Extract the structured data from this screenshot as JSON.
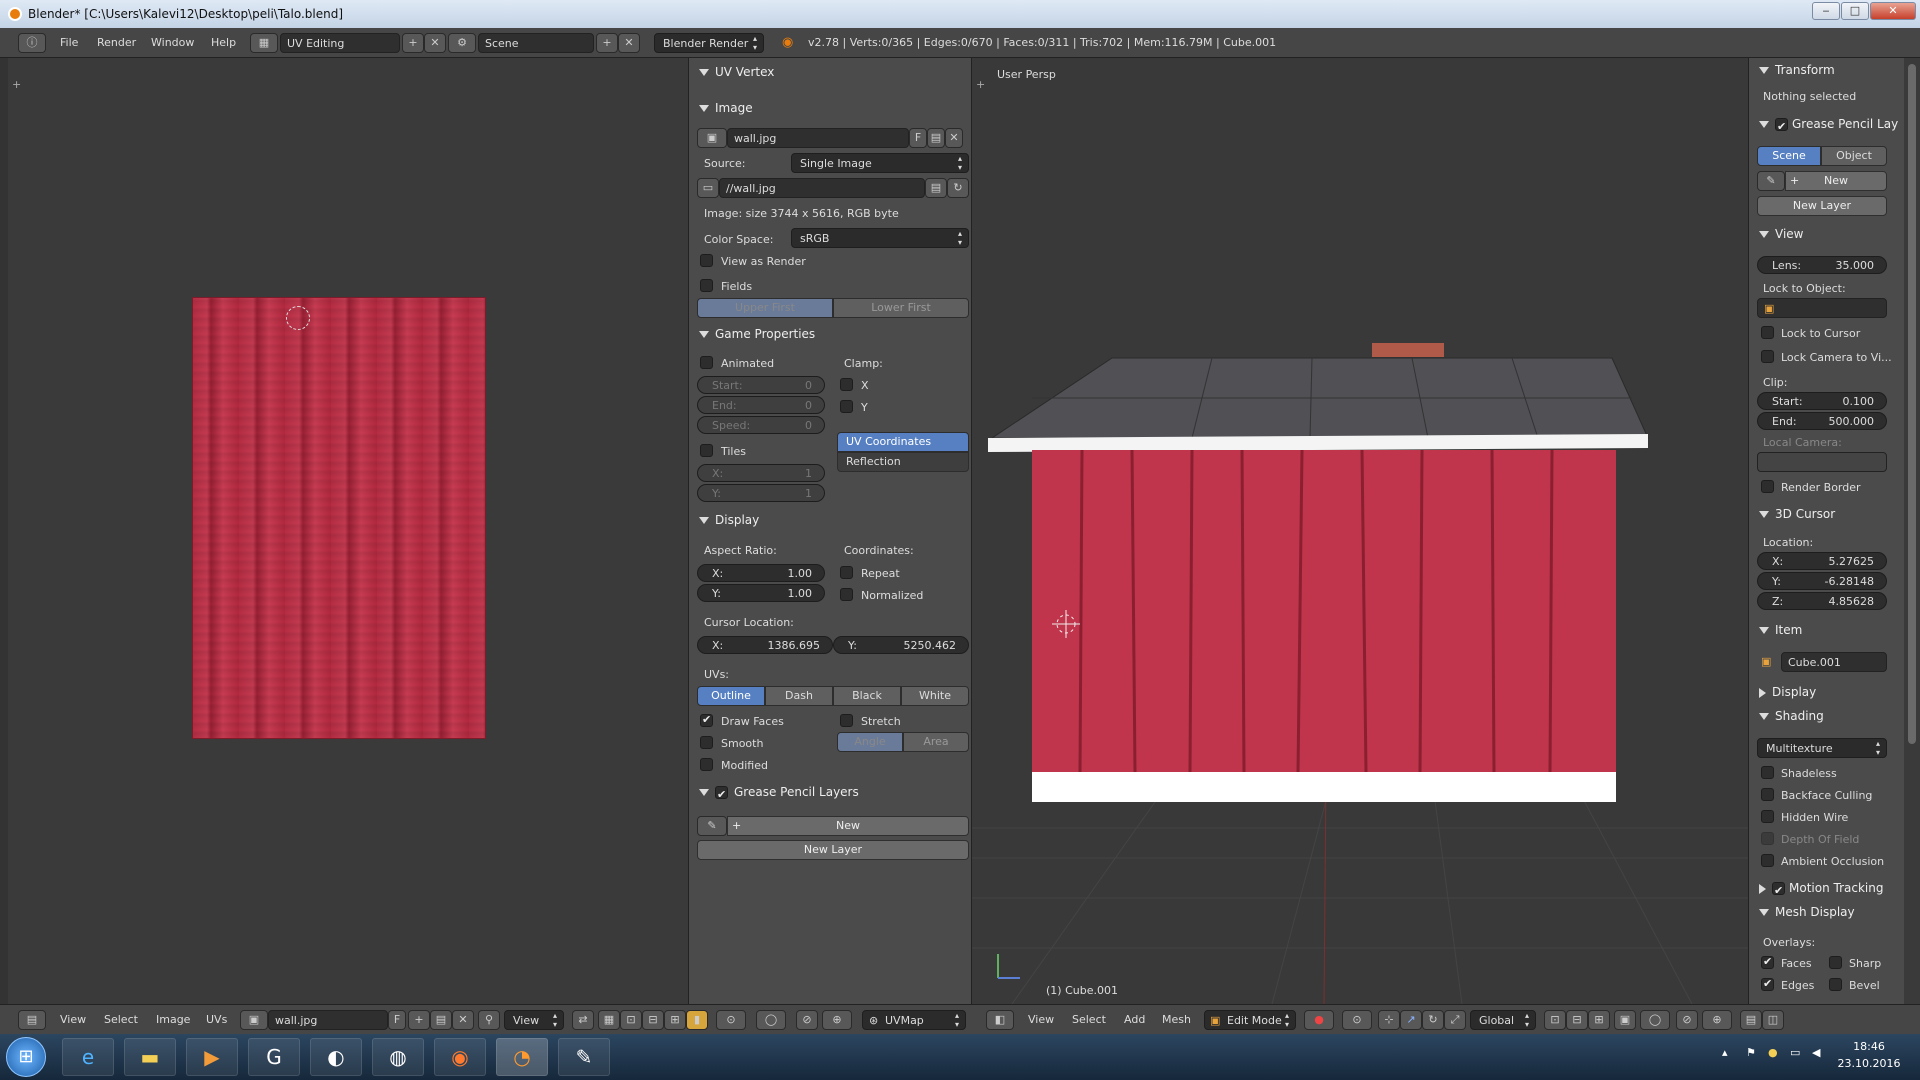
{
  "window": {
    "title": "Blender* [C:\\Users\\Kalevi12\\Desktop\\peli\\Talo.blend]",
    "min": "‒",
    "max": "□",
    "close": "✕"
  },
  "topbar": {
    "menus": [
      "File",
      "Render",
      "Window",
      "Help"
    ],
    "layout": "UV Editing",
    "scene": "Scene",
    "engine": "Blender Render",
    "info": "v2.78 | Verts:0/365 | Edges:0/670 | Faces:0/311 | Tris:702 | Mem:116.79M | Cube.001"
  },
  "uv_panel": {
    "uv_vertex": "UV Vertex",
    "image": {
      "header": "Image",
      "name": "wall.jpg",
      "f": "F",
      "source_label": "Source:",
      "source": "Single Image",
      "path": "//wall.jpg",
      "size": "Image: size 3744 x 5616, RGB byte",
      "colorspace_label": "Color Space:",
      "colorspace": "sRGB",
      "view_as_render": "View as Render",
      "fields": "Fields",
      "upper_first": "Upper First",
      "lower_first": "Lower First"
    },
    "game": {
      "header": "Game Properties",
      "animated": "Animated",
      "start_l": "Start:",
      "start_v": "0",
      "end_l": "End:",
      "end_v": "0",
      "speed_l": "Speed:",
      "speed_v": "0",
      "clamp": "Clamp:",
      "x": "X",
      "y": "Y",
      "uv_coords": "UV Coordinates",
      "reflection": "Reflection",
      "tiles": "Tiles",
      "tx_l": "X:",
      "tx_v": "1",
      "ty_l": "Y:",
      "ty_v": "1"
    },
    "display": {
      "header": "Display",
      "aspect": "Aspect Ratio:",
      "ax_l": "X:",
      "ax_v": "1.00",
      "ay_l": "Y:",
      "ay_v": "1.00",
      "coords": "Coordinates:",
      "repeat": "Repeat",
      "normalized": "Normalized",
      "cursor_loc": "Cursor Location:",
      "cx_l": "X:",
      "cx_v": "1386.695",
      "cy_l": "Y:",
      "cy_v": "5250.462",
      "uvs": "UVs:",
      "outline": "Outline",
      "dash": "Dash",
      "black": "Black",
      "white": "White",
      "draw_faces": "Draw Faces",
      "stretch": "Stretch",
      "smooth": "Smooth",
      "angle": "Angle",
      "area": "Area",
      "modified": "Modified"
    },
    "grease": {
      "header": "Grease Pencil Layers",
      "new": "New",
      "new_layer": "New Layer"
    }
  },
  "view3d": {
    "label": "User Persp",
    "object": "(1) Cube.001"
  },
  "npanel": {
    "transform": "Transform",
    "nothing": "Nothing selected",
    "grease": "Grease Pencil Lay",
    "scene": "Scene",
    "object": "Object",
    "new": "New",
    "new_layer": "New Layer",
    "view": "View",
    "lens_l": "Lens:",
    "lens_v": "35.000",
    "lock_obj": "Lock to Object:",
    "lock_cursor": "Lock to Cursor",
    "lock_cam": "Lock Camera to Vi...",
    "clip": "Clip:",
    "start_l": "Start:",
    "start_v": "0.100",
    "end_l": "End:",
    "end_v": "500.000",
    "local_cam": "Local Camera:",
    "render_border": "Render Border",
    "cursor3d": "3D Cursor",
    "location": "Location:",
    "x_l": "X:",
    "x_v": "5.27625",
    "y_l": "Y:",
    "y_v": "-6.28148",
    "z_l": "Z:",
    "z_v": "4.85628",
    "item": "Item",
    "item_name": "Cube.001",
    "display": "Display",
    "shading": "Shading",
    "multitexture": "Multitexture",
    "shadeless": "Shadeless",
    "backface": "Backface Culling",
    "hidden_wire": "Hidden Wire",
    "dof": "Depth Of Field",
    "ao": "Ambient Occlusion",
    "motion": "Motion Tracking",
    "mesh_display": "Mesh Display",
    "overlays": "Overlays:",
    "faces": "Faces",
    "sharp": "Sharp",
    "edges": "Edges",
    "bevel": "Bevel"
  },
  "bottom_uv": {
    "menus": [
      "View",
      "Select",
      "Image",
      "UVs"
    ],
    "image": "wall.jpg",
    "f": "F",
    "view": "View",
    "uvmap": "UVMap"
  },
  "bottom_3d": {
    "menus": [
      "View",
      "Select",
      "Add",
      "Mesh"
    ],
    "mode": "Edit Mode",
    "orient": "Global"
  },
  "taskbar": {
    "time": "18:46",
    "date": "23.10.2016"
  },
  "colors": {
    "accent": "#5680c2",
    "wood": "#c0354b",
    "roof": "#555"
  }
}
